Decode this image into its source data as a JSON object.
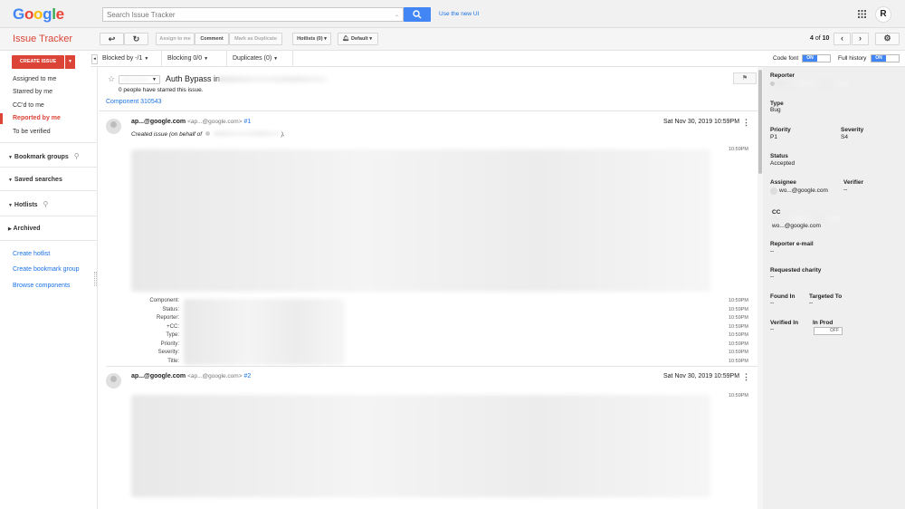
{
  "header": {
    "logo_letters": [
      "G",
      "o",
      "o",
      "g",
      "l",
      "e"
    ],
    "logo_colors": [
      "#4285f4",
      "#ea4335",
      "#fbbc05",
      "#4285f4",
      "#34a853",
      "#ea4335"
    ],
    "search_placeholder": "Search Issue Tracker",
    "use_new_ui": "Use the new UI",
    "avatar_letter": "R"
  },
  "toolbar": {
    "app_title": "Issue Tracker",
    "assign_to_me": "Assign to me",
    "comment": "Comment",
    "mark_duplicate": "Mark as Duplicate",
    "hotlists": "Hotlists (0) ▾",
    "default": "Default ▾",
    "page_count_current": "4",
    "page_count_of": "of",
    "page_count_total": "10"
  },
  "sidebar": {
    "create_issue": "CREATE ISSUE",
    "items": [
      {
        "label": "Assigned to me"
      },
      {
        "label": "Starred by me"
      },
      {
        "label": "CC'd to me"
      },
      {
        "label": "Reported by me"
      },
      {
        "label": "To be verified"
      }
    ],
    "sections": {
      "bookmark_groups": "Bookmark groups",
      "saved_searches": "Saved searches",
      "hotlists": "Hotlists",
      "archived": "Archived"
    },
    "links": {
      "create_hotlist": "Create hotlist",
      "create_bookmark_group": "Create bookmark group",
      "browse_components": "Browse components"
    }
  },
  "relations": {
    "blocked_by": "Blocked by -/1",
    "blocking": "Blocking 0/0",
    "duplicates": "Duplicates (0)"
  },
  "issue": {
    "title_prefix": "Auth Bypass in",
    "starred_text": "0 people have starred this issue.",
    "component": "Component 310543"
  },
  "comments": [
    {
      "author": "ap...@google.com",
      "author_email": "<ap...@google.com>",
      "number": "#1",
      "date": "Sat Nov 30, 2019 10:59PM",
      "created_text": "Created issue (on behalf of",
      "created_suffix": ").",
      "time": "10:59PM"
    },
    {
      "author": "ap...@google.com",
      "author_email": "<ap...@google.com>",
      "number": "#2",
      "date": "Sat Nov 30, 2019 10:59PM",
      "time": "10:59PM"
    }
  ],
  "field_changes": [
    {
      "label": "Component:",
      "time": "10:59PM"
    },
    {
      "label": "Status:",
      "time": "10:59PM"
    },
    {
      "label": "Reporter:",
      "time": "10:59PM"
    },
    {
      "label": "+CC:",
      "time": "10:59PM"
    },
    {
      "label": "Type:",
      "time": "10:59PM"
    },
    {
      "label": "Priority:",
      "time": "10:59PM"
    },
    {
      "label": "Severity:",
      "time": "10:59PM"
    },
    {
      "label": "Title:",
      "time": "10:59PM"
    }
  ],
  "right_panel": {
    "code_font": "Code font",
    "full_history": "Full history",
    "on": "ON",
    "off": "OFF",
    "reporter_label": "Reporter",
    "type_label": "Type",
    "type_value": "Bug",
    "priority_label": "Priority",
    "priority_value": "P1",
    "severity_label": "Severity",
    "severity_value": "S4",
    "status_label": "Status",
    "status_value": "Accepted",
    "assignee_label": "Assignee",
    "assignee_value": "wo...@google.com",
    "verifier_label": "Verifier",
    "verifier_value": "--",
    "cc_label": "CC",
    "cc_value": "wo...@google.com",
    "reporter_email_label": "Reporter e-mail",
    "reporter_email_value": "--",
    "requested_charity_label": "Requested charity",
    "requested_charity_value": "--",
    "found_in_label": "Found In",
    "found_in_value": "--",
    "targeted_to_label": "Targeted To",
    "targeted_to_value": "--",
    "verified_in_label": "Verified In",
    "verified_in_value": "--",
    "in_prod_label": "In Prod"
  }
}
